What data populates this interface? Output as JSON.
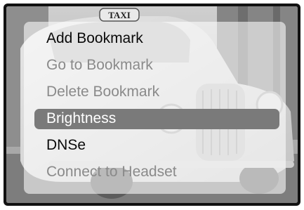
{
  "menu": {
    "items": [
      {
        "label": "Add Bookmark",
        "state": "enabled"
      },
      {
        "label": "Go to Bookmark",
        "state": "disabled"
      },
      {
        "label": "Delete Bookmark",
        "state": "disabled"
      },
      {
        "label": "Brightness",
        "state": "selected"
      },
      {
        "label": "DNSe",
        "state": "enabled"
      },
      {
        "label": "Connect to Headset",
        "state": "disabled"
      }
    ]
  },
  "background": {
    "sign_text": "TAXI"
  },
  "colors": {
    "frame": "#111111",
    "highlight": "#7a7a7a",
    "enabled_text": "#0a0a0a",
    "disabled_text": "#8a8a8a",
    "selected_text": "#ffffff"
  }
}
